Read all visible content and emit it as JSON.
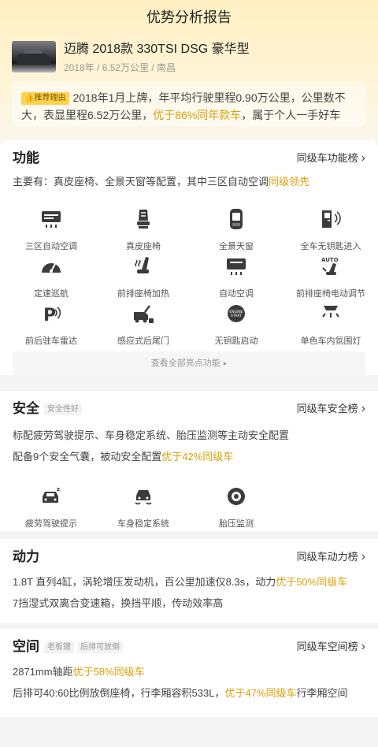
{
  "header": {
    "title": "优势分析报告"
  },
  "car": {
    "name": "迈腾 2018款 330TSI DSG 豪华型",
    "meta": "2018年 / 6.52万公里 / 南昌"
  },
  "reason": {
    "badge": "推荐理由",
    "text_before": "2018年1月上牌，年平均行驶里程0.90万公里，公里数不大，表显里程6.52万公里，",
    "highlight": "优于86%同年款车",
    "text_after": "，属于个人一手好车"
  },
  "features": {
    "title": "功能",
    "link": "同级车功能榜",
    "desc_before": "主要有：真皮座椅、全景天窗等配置，其中三区自动空调",
    "desc_highlight": "同级领先",
    "items": [
      {
        "label": "三区自动空调",
        "icon": "ac-vent-icon"
      },
      {
        "label": "真皮座椅",
        "icon": "leather-seat-icon"
      },
      {
        "label": "全景天窗",
        "icon": "sunroof-icon"
      },
      {
        "label": "全车无钥匙进入",
        "icon": "keyless-entry-icon"
      },
      {
        "label": "定速巡航",
        "icon": "cruise-control-icon"
      },
      {
        "label": "前排座椅加热",
        "icon": "seat-heating-icon"
      },
      {
        "label": "自动空调",
        "icon": "auto-ac-icon"
      },
      {
        "label": "前排座椅电动调节",
        "icon": "power-seat-icon"
      },
      {
        "label": "前后驻车雷达",
        "icon": "parking-radar-icon"
      },
      {
        "label": "感应式后尾门",
        "icon": "tailgate-sensor-icon"
      },
      {
        "label": "无钥匙启动",
        "icon": "start-button-icon"
      },
      {
        "label": "单色车内氛围灯",
        "icon": "ambient-light-icon"
      }
    ],
    "see_all": "查看全部亮点功能"
  },
  "safety": {
    "title": "安全",
    "tag": "安全性好",
    "link": "同级车安全榜",
    "line1": "标配疲劳驾驶提示、车身稳定系统、胎压监测等主动安全配置",
    "line2_before": "配备9个安全气囊，被动安全配置",
    "line2_highlight": "优于42%同级车",
    "items": [
      {
        "label": "疲劳驾驶提示",
        "icon": "fatigue-alert-icon"
      },
      {
        "label": "车身稳定系统",
        "icon": "stability-control-icon"
      },
      {
        "label": "胎压监测",
        "icon": "tire-pressure-icon"
      }
    ]
  },
  "power": {
    "title": "动力",
    "link": "同级车动力榜",
    "line1_before": "1.8T 直列4缸，涡轮增压发动机，百公里加速仅8.3s，动力",
    "line1_highlight": "优于50%同级车",
    "line2": "7挡湿式双离合变速箱，换挡平顺，传动效率高"
  },
  "space": {
    "title": "空间",
    "tags": [
      "老板键",
      "后排可放倒"
    ],
    "link": "同级车空间榜",
    "line1_before": "2871mm轴距",
    "line1_highlight": "优于58%同级车",
    "line2_before": "后排可40:60比例放倒座椅，行李厢容积533L，",
    "line2_highlight": "优于47%同级车",
    "line2_after": "行李厢空间"
  },
  "colors": {
    "highlight": "#d7a20b",
    "badge": "#ffd24c",
    "hero": "#fff0c2"
  }
}
